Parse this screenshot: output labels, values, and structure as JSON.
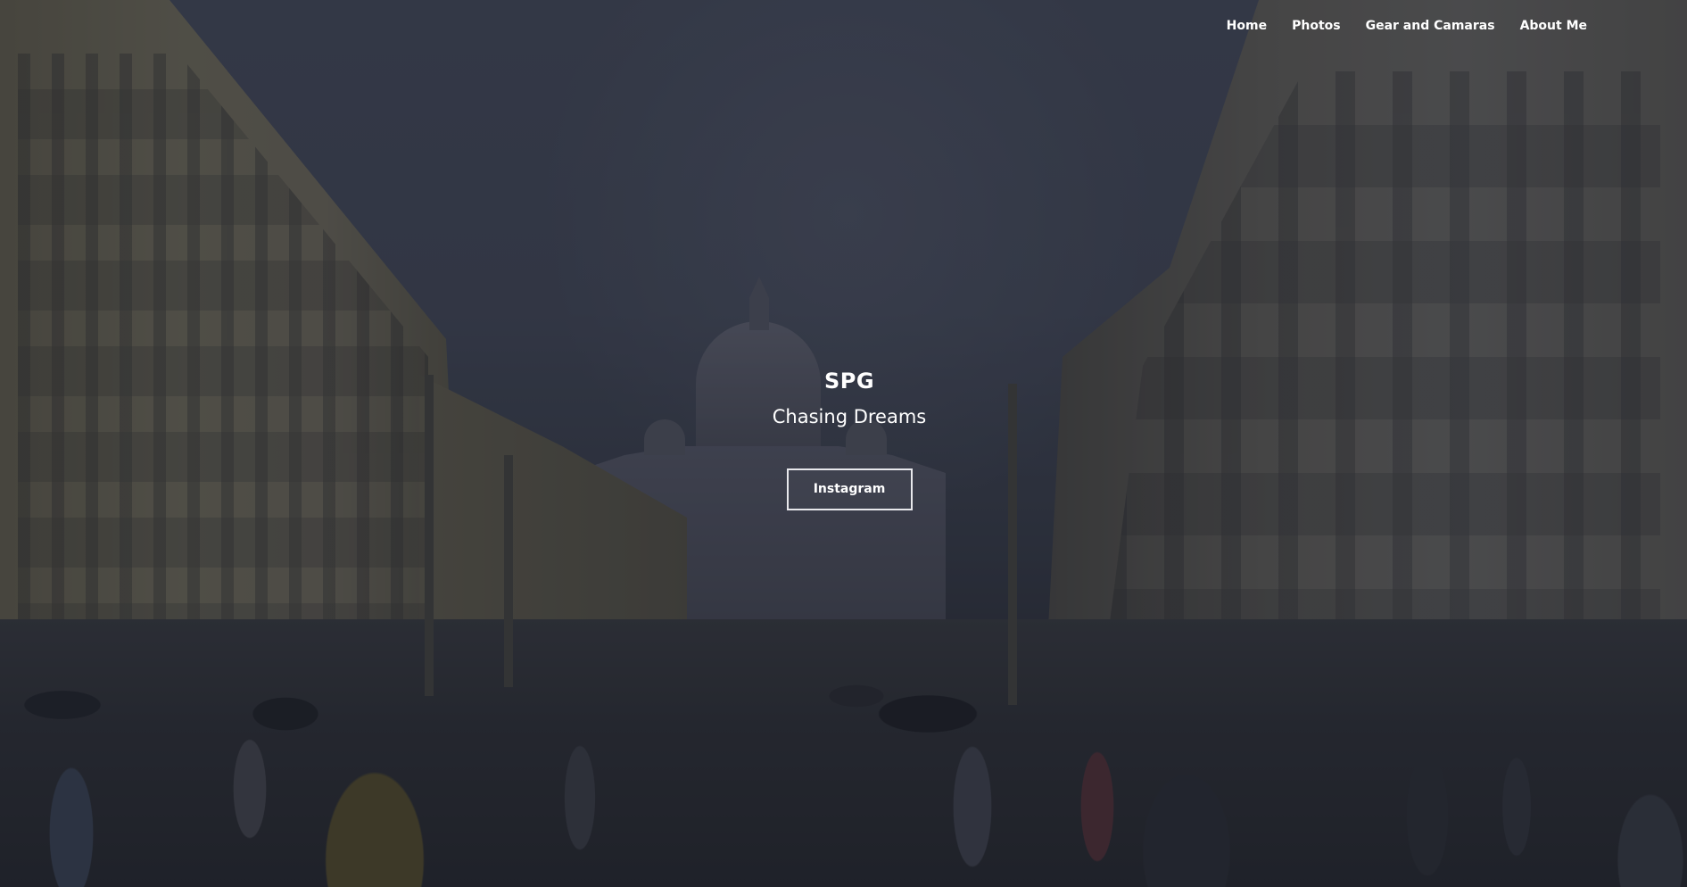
{
  "nav": {
    "items": [
      {
        "label": "Home"
      },
      {
        "label": "Photos"
      },
      {
        "label": "Gear and Camaras"
      },
      {
        "label": "About Me"
      }
    ]
  },
  "hero": {
    "title": "SPG",
    "subtitle": "Chasing Dreams",
    "button_label": "Instagram",
    "background_image": "street-view-to-basilica-dome-at-dusk"
  },
  "colors": {
    "overlay": "#181c28",
    "text": "#ffffff",
    "button_border": "#e8e8ec"
  }
}
